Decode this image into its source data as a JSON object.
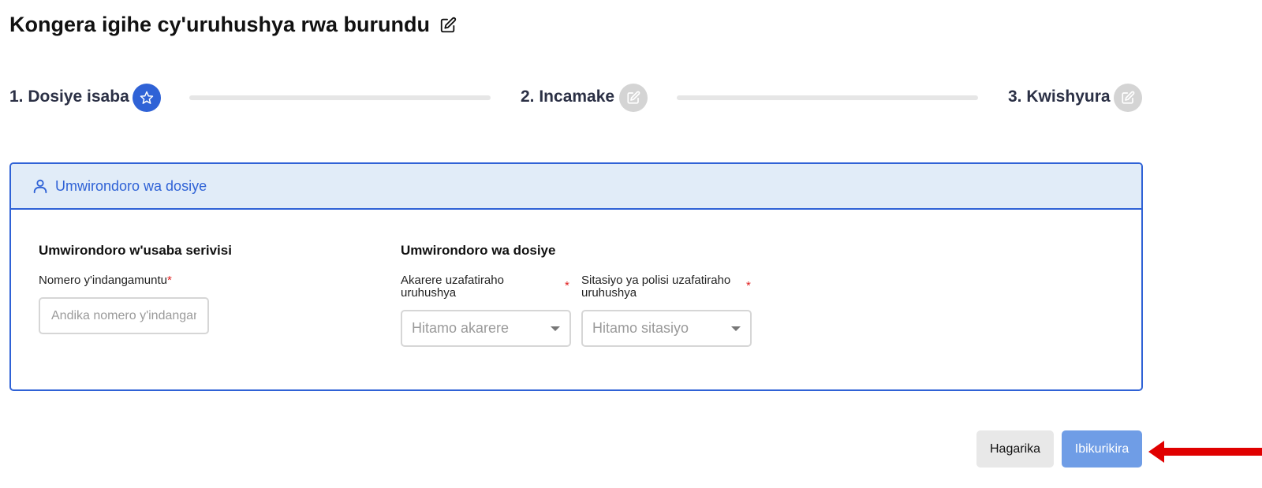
{
  "page": {
    "title": "Kongera igihe cy'uruhushya rwa burundu"
  },
  "stepper": {
    "steps": [
      {
        "label": "1. Dosiye isaba",
        "state": "active",
        "icon": "star-icon"
      },
      {
        "label": "2. Incamake",
        "state": "inactive",
        "icon": "edit-icon"
      },
      {
        "label": "3. Kwishyura",
        "state": "inactive",
        "icon": "edit-icon"
      }
    ]
  },
  "card": {
    "header_title": "Umwirondoro wa dosiye",
    "applicant": {
      "section_title": "Umwirondoro w'usaba serivisi",
      "id_label": "Nomero y'indangamuntu",
      "id_placeholder": "Andika nomero y'indangamuntu",
      "id_value": ""
    },
    "file": {
      "section_title": "Umwirondoro wa dosiye",
      "district_label": "Akarere uzafatiraho uruhushya",
      "district_placeholder": "Hitamo akarere",
      "station_label": "Sitasiyo ya polisi uzafatiraho uruhushya",
      "station_placeholder": "Hitamo sitasiyo"
    },
    "required_mark": "*"
  },
  "actions": {
    "cancel_label": "Hagarika",
    "submit_label": "Ibikurikira"
  },
  "colors": {
    "primary": "#2f62d6",
    "header_bg": "#e1ecf8",
    "submit_bg": "#6f9de6",
    "required": "#e02020",
    "annotation_arrow": "#e00000"
  }
}
